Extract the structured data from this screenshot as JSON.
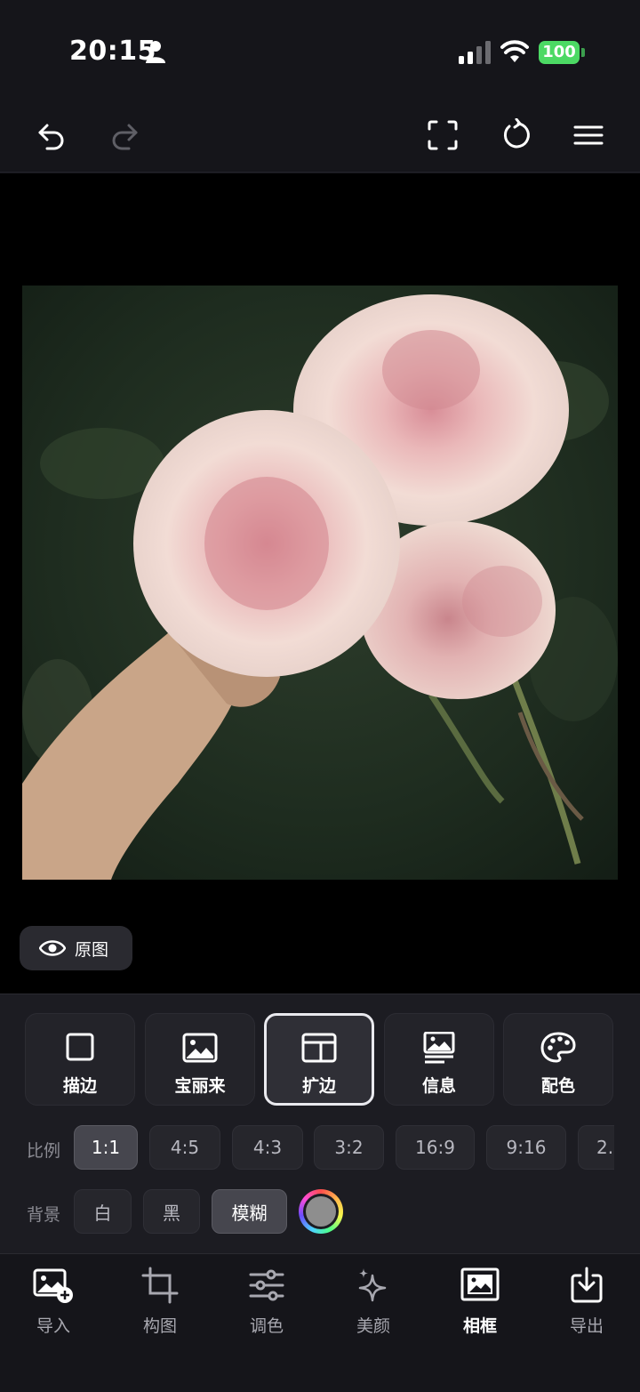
{
  "status_bar": {
    "time": "20:15",
    "battery": "100"
  },
  "toolbar": {
    "undo_icon": "undo-icon",
    "redo_icon": "redo-icon",
    "fullscreen_icon": "fullscreen-icon",
    "reset_icon": "reset-icon",
    "menu_icon": "menu-icon"
  },
  "canvas": {
    "original_label": "原图"
  },
  "frames": [
    {
      "label": "描边",
      "icon": "square-outline-icon",
      "active": false
    },
    {
      "label": "宝丽来",
      "icon": "polaroid-icon",
      "active": false
    },
    {
      "label": "扩边",
      "icon": "expand-border-icon",
      "active": true
    },
    {
      "label": "信息",
      "icon": "info-frame-icon",
      "active": false
    },
    {
      "label": "配色",
      "icon": "palette-icon",
      "active": false
    }
  ],
  "ratio": {
    "label": "比例",
    "options": [
      "1:1",
      "4:5",
      "4:3",
      "3:2",
      "16:9",
      "9:16",
      "2."
    ],
    "selected": "1:1"
  },
  "background": {
    "label": "背景",
    "options": [
      "白",
      "黑",
      "模糊"
    ],
    "selected": "模糊",
    "custom_color": "#8e8e8e"
  },
  "bottom_nav": [
    {
      "label": "导入",
      "icon": "import-image-icon",
      "active": false
    },
    {
      "label": "构图",
      "icon": "crop-icon",
      "active": false
    },
    {
      "label": "调色",
      "icon": "sliders-icon",
      "active": false
    },
    {
      "label": "美颜",
      "icon": "sparkle-icon",
      "active": false
    },
    {
      "label": "相框",
      "icon": "frame-icon",
      "active": true
    },
    {
      "label": "导出",
      "icon": "export-icon",
      "active": false
    }
  ]
}
